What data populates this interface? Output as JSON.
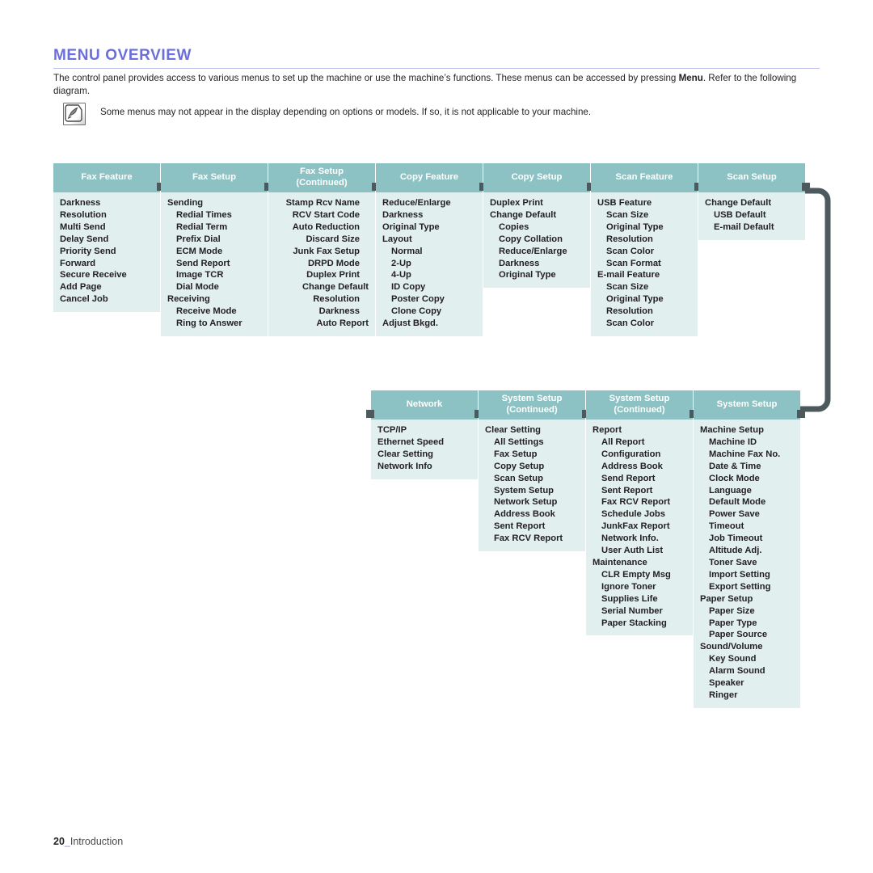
{
  "header": {
    "title": "MENU OVERVIEW",
    "intro_before": "The control panel provides access to various menus to set up the machine or use the machine’s functions. These menus can be accessed by pressing ",
    "intro_bold": "Menu",
    "intro_after": ". Refer to the following diagram."
  },
  "note": {
    "icon": "note-pen-icon",
    "text": "Some menus may not appear in the display depending on options or models. If so, it is not applicable to your machine."
  },
  "colors": {
    "title": "#6b6fdd",
    "box_header": "#8cc2c4",
    "box_body": "#e2efef",
    "connector": "#4c595d",
    "rule": "#b9bce8"
  },
  "footer": {
    "page": "20",
    "separator": "_",
    "section": "Introduction"
  },
  "diagram": {
    "row1": [
      {
        "title": "Fax Feature",
        "subtitle": "",
        "align": "left",
        "items": [
          {
            "label": "Darkness",
            "level": 1
          },
          {
            "label": "Resolution",
            "level": 1
          },
          {
            "label": "Multi Send",
            "level": 1
          },
          {
            "label": "Delay Send",
            "level": 1
          },
          {
            "label": "Priority Send",
            "level": 1
          },
          {
            "label": "Forward",
            "level": 1
          },
          {
            "label": "Secure Receive",
            "level": 1
          },
          {
            "label": "Add Page",
            "level": 1
          },
          {
            "label": "Cancel Job",
            "level": 1
          }
        ]
      },
      {
        "title": "Fax Setup",
        "subtitle": "",
        "align": "left",
        "items": [
          {
            "label": "Sending",
            "level": 1
          },
          {
            "label": "Redial Times",
            "level": 2
          },
          {
            "label": "Redial Term",
            "level": 2
          },
          {
            "label": "Prefix Dial",
            "level": 2
          },
          {
            "label": "ECM Mode",
            "level": 2
          },
          {
            "label": "Send Report",
            "level": 2
          },
          {
            "label": "Image TCR",
            "level": 2
          },
          {
            "label": "Dial Mode",
            "level": 2
          },
          {
            "label": "Receiving",
            "level": 1
          },
          {
            "label": "Receive Mode",
            "level": 2
          },
          {
            "label": "Ring to Answer",
            "level": 2
          }
        ]
      },
      {
        "title": "Fax Setup",
        "subtitle": "(Continued)",
        "align": "right",
        "items": [
          {
            "label": "Stamp Rcv Name",
            "level": 2
          },
          {
            "label": "RCV Start Code",
            "level": 2
          },
          {
            "label": "Auto Reduction",
            "level": 2
          },
          {
            "label": "Discard Size",
            "level": 2
          },
          {
            "label": "Junk Fax Setup",
            "level": 2
          },
          {
            "label": "DRPD Mode",
            "level": 2
          },
          {
            "label": "Duplex Print",
            "level": 2
          },
          {
            "label": "Change Default",
            "level": 1
          },
          {
            "label": "Resolution",
            "level": 2
          },
          {
            "label": "Darkness",
            "level": 2
          },
          {
            "label": "Auto Report",
            "level": 1
          }
        ]
      },
      {
        "title": "Copy Feature",
        "subtitle": "",
        "align": "left",
        "items": [
          {
            "label": "Reduce/Enlarge",
            "level": 1
          },
          {
            "label": "Darkness",
            "level": 1
          },
          {
            "label": "Original Type",
            "level": 1
          },
          {
            "label": "Layout",
            "level": 1
          },
          {
            "label": "Normal",
            "level": 2
          },
          {
            "label": "2-Up",
            "level": 2
          },
          {
            "label": "4-Up",
            "level": 2
          },
          {
            "label": "ID Copy",
            "level": 2
          },
          {
            "label": "Poster Copy",
            "level": 2
          },
          {
            "label": "Clone Copy",
            "level": 2
          },
          {
            "label": "Adjust Bkgd.",
            "level": 1
          }
        ]
      },
      {
        "title": "Copy Setup",
        "subtitle": "",
        "align": "left",
        "items": [
          {
            "label": "Duplex Print",
            "level": 1
          },
          {
            "label": "Change Default",
            "level": 1
          },
          {
            "label": "Copies",
            "level": 2
          },
          {
            "label": "Copy Collation",
            "level": 2
          },
          {
            "label": "Reduce/Enlarge",
            "level": 2
          },
          {
            "label": "Darkness",
            "level": 2
          },
          {
            "label": "Original Type",
            "level": 2
          }
        ]
      },
      {
        "title": "Scan Feature",
        "subtitle": "",
        "align": "left",
        "items": [
          {
            "label": "USB Feature",
            "level": 1
          },
          {
            "label": "Scan Size",
            "level": 2
          },
          {
            "label": "Original Type",
            "level": 2
          },
          {
            "label": "Resolution",
            "level": 2
          },
          {
            "label": "Scan Color",
            "level": 2
          },
          {
            "label": "Scan Format",
            "level": 2
          },
          {
            "label": "E-mail Feature",
            "level": 1
          },
          {
            "label": "Scan Size",
            "level": 2
          },
          {
            "label": "Original Type",
            "level": 2
          },
          {
            "label": "Resolution",
            "level": 2
          },
          {
            "label": "Scan Color",
            "level": 2
          }
        ]
      },
      {
        "title": "Scan Setup",
        "subtitle": "",
        "align": "left",
        "items": [
          {
            "label": "Change Default",
            "level": 1
          },
          {
            "label": "USB Default",
            "level": 2
          },
          {
            "label": "E-mail Default",
            "level": 2
          }
        ]
      }
    ],
    "row2": [
      {
        "title": "Network",
        "subtitle": "",
        "align": "left",
        "items": [
          {
            "label": "TCP/IP",
            "level": 1
          },
          {
            "label": "Ethernet Speed",
            "level": 1
          },
          {
            "label": "Clear Setting",
            "level": 1
          },
          {
            "label": "Network Info",
            "level": 1
          }
        ]
      },
      {
        "title": "System Setup",
        "subtitle": "(Continued)",
        "align": "left",
        "items": [
          {
            "label": "Clear Setting",
            "level": 1
          },
          {
            "label": "All Settings",
            "level": 2
          },
          {
            "label": "Fax Setup",
            "level": 2
          },
          {
            "label": "Copy Setup",
            "level": 2
          },
          {
            "label": "Scan Setup",
            "level": 2
          },
          {
            "label": "System Setup",
            "level": 2
          },
          {
            "label": "Network Setup",
            "level": 2
          },
          {
            "label": "Address Book",
            "level": 2
          },
          {
            "label": "Sent Report",
            "level": 2
          },
          {
            "label": "Fax RCV Report",
            "level": 2
          }
        ]
      },
      {
        "title": "System Setup",
        "subtitle": "(Continued)",
        "align": "left",
        "items": [
          {
            "label": "Report",
            "level": 1
          },
          {
            "label": "All Report",
            "level": 2
          },
          {
            "label": "Configuration",
            "level": 2
          },
          {
            "label": "Address Book",
            "level": 2
          },
          {
            "label": "Send Report",
            "level": 2
          },
          {
            "label": "Sent Report",
            "level": 2
          },
          {
            "label": "Fax RCV Report",
            "level": 2
          },
          {
            "label": "Schedule Jobs",
            "level": 2
          },
          {
            "label": "JunkFax Report",
            "level": 2
          },
          {
            "label": "Network Info.",
            "level": 2
          },
          {
            "label": "User Auth List",
            "level": 2
          },
          {
            "label": "Maintenance",
            "level": 1
          },
          {
            "label": "CLR Empty Msg",
            "level": 2
          },
          {
            "label": "Ignore Toner",
            "level": 2
          },
          {
            "label": "Supplies Life",
            "level": 2
          },
          {
            "label": "Serial Number",
            "level": 2
          },
          {
            "label": "Paper Stacking",
            "level": 2
          }
        ]
      },
      {
        "title": "System Setup",
        "subtitle": "",
        "align": "left",
        "items": [
          {
            "label": "Machine Setup",
            "level": 1
          },
          {
            "label": "Machine ID",
            "level": 2
          },
          {
            "label": "Machine Fax No.",
            "level": 2
          },
          {
            "label": "Date & Time",
            "level": 2
          },
          {
            "label": "Clock Mode",
            "level": 2
          },
          {
            "label": "Language",
            "level": 2
          },
          {
            "label": "Default Mode",
            "level": 2
          },
          {
            "label": "Power Save",
            "level": 2
          },
          {
            "label": "Timeout",
            "level": 2
          },
          {
            "label": "Job Timeout",
            "level": 2
          },
          {
            "label": "Altitude Adj.",
            "level": 2
          },
          {
            "label": "Toner Save",
            "level": 2
          },
          {
            "label": "Import Setting",
            "level": 2
          },
          {
            "label": "Export Setting",
            "level": 2
          },
          {
            "label": "Paper Setup",
            "level": 1
          },
          {
            "label": "Paper Size",
            "level": 2
          },
          {
            "label": "Paper Type",
            "level": 2
          },
          {
            "label": "Paper Source",
            "level": 2
          },
          {
            "label": "Sound/Volume",
            "level": 1
          },
          {
            "label": "Key Sound",
            "level": 2
          },
          {
            "label": "Alarm Sound",
            "level": 2
          },
          {
            "label": "Speaker",
            "level": 2
          },
          {
            "label": "Ringer",
            "level": 2
          }
        ]
      }
    ]
  }
}
